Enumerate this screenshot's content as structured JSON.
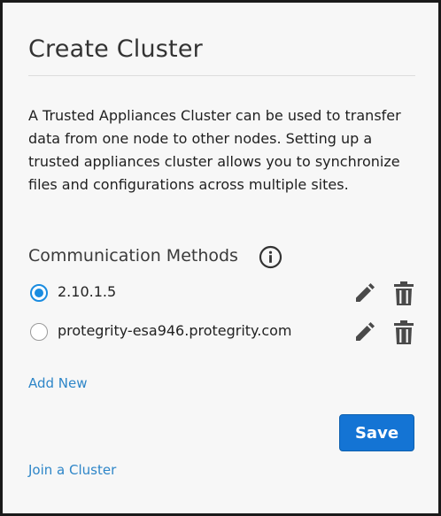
{
  "dialog": {
    "title": "Create Cluster",
    "description": "A Trusted Appliances Cluster can be used to transfer data from one node to other nodes. Setting up a trusted appliances cluster allows you to synchronize files and configurations across multiple sites."
  },
  "communication_methods": {
    "heading": "Communication Methods",
    "info_icon": "info-circle-icon",
    "items": [
      {
        "label": "2.10.1.5",
        "selected": true
      },
      {
        "label": "protegrity-esa946.protegrity.com",
        "selected": false
      }
    ],
    "edit_icon": "pencil-icon",
    "delete_icon": "trash-icon"
  },
  "actions": {
    "add_new_label": "Add New",
    "save_label": "Save",
    "join_label": "Join a Cluster"
  },
  "colors": {
    "accent": "#1a8ce0",
    "link": "#2e86c8",
    "button": "#1474d4"
  }
}
